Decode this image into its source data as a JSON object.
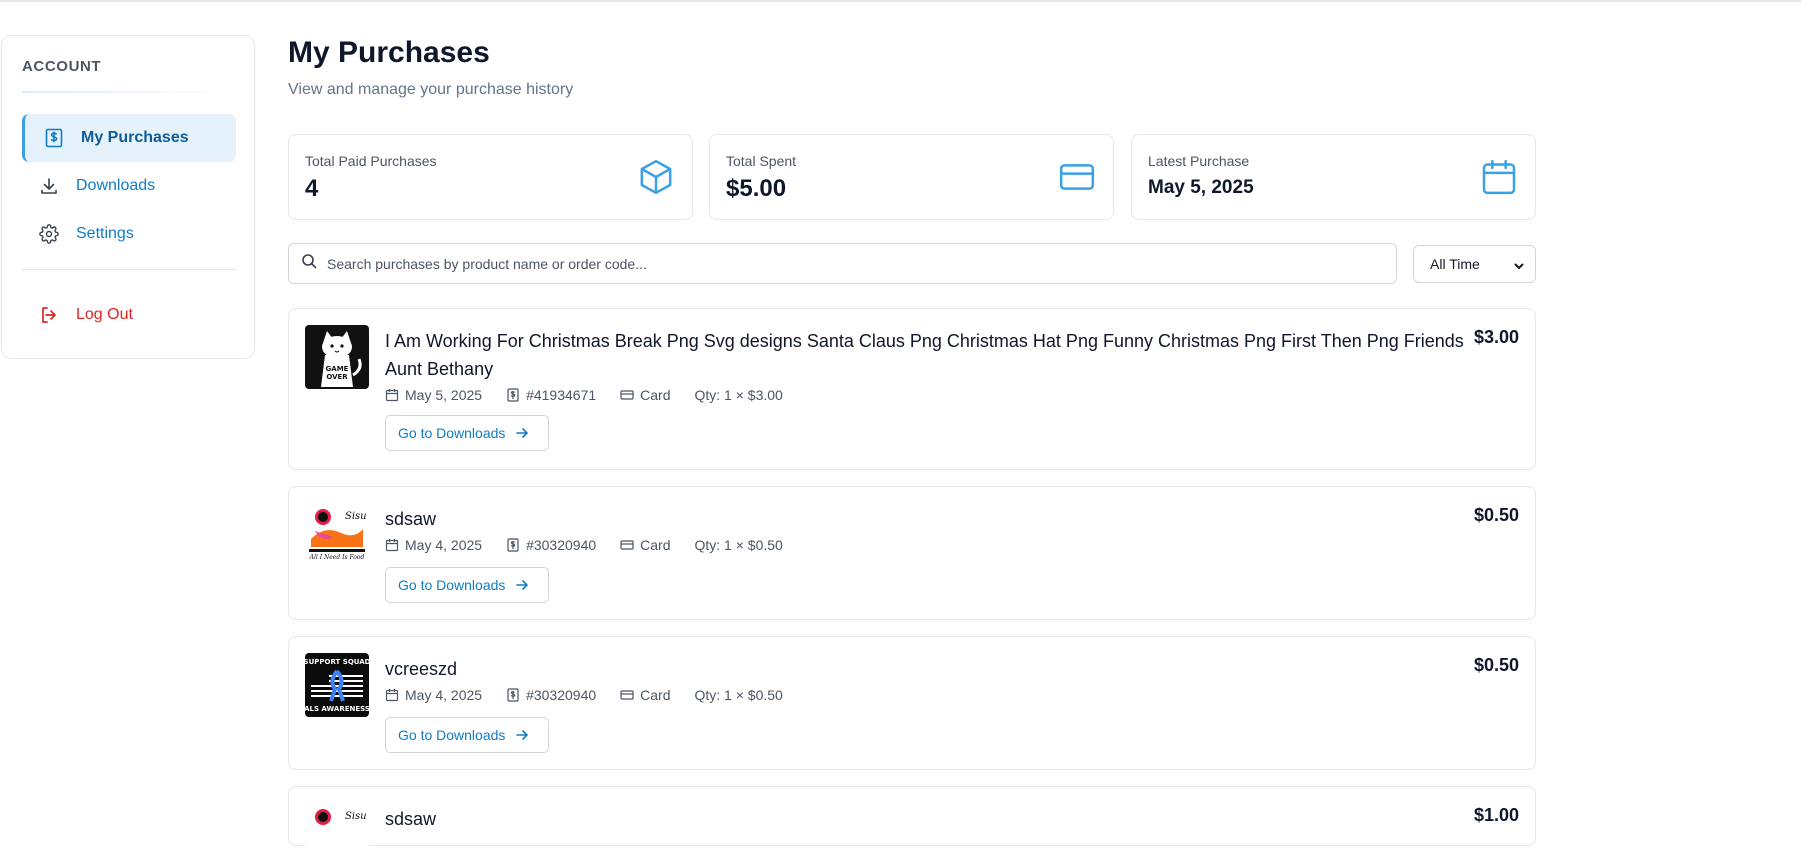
{
  "sidebar": {
    "title": "ACCOUNT",
    "items": [
      {
        "label": "My Purchases",
        "icon": "dollar-receipt-icon",
        "active": true
      },
      {
        "label": "Downloads",
        "icon": "download-icon"
      },
      {
        "label": "Settings",
        "icon": "gear-icon"
      }
    ],
    "logout_label": "Log Out"
  },
  "header": {
    "title": "My Purchases",
    "subtitle": "View and manage your purchase history"
  },
  "stats": [
    {
      "label": "Total Paid Purchases",
      "value": "4",
      "icon": "box-icon"
    },
    {
      "label": "Total Spent",
      "value": "$5.00",
      "icon": "credit-card-icon"
    },
    {
      "label": "Latest Purchase",
      "value": "May 5, 2025",
      "icon": "calendar-icon"
    }
  ],
  "search": {
    "placeholder": "Search purchases by product name or order code...",
    "value": ""
  },
  "filter": {
    "selected": "All Time"
  },
  "purchases": [
    {
      "title_line1": "I Am Working For Christmas Break Png Svg designs Santa Claus Png Christmas Hat Png Funny Christmas Png First Then Png Friends",
      "title_line2": "Aunt Bethany",
      "price": "$3.00",
      "date": "May 5, 2025",
      "order": "#41934671",
      "payment": "Card",
      "qty": "Qty: 1 × $3.00",
      "button": "Go to Downloads",
      "thumb_text": "GAME OVER"
    },
    {
      "title_line1": "sdsaw",
      "price": "$0.50",
      "date": "May 4, 2025",
      "order": "#30320940",
      "payment": "Card",
      "qty": "Qty: 1 × $0.50",
      "button": "Go to Downloads"
    },
    {
      "title_line1": "vcreeszd",
      "price": "$0.50",
      "date": "May 4, 2025",
      "order": "#30320940",
      "payment": "Card",
      "qty": "Qty: 1 × $0.50",
      "button": "Go to Downloads",
      "thumb_text_top": "SUPPORT SQUAD",
      "thumb_text_bottom": "ALS AWARENESS"
    },
    {
      "title_line1": "sdsaw",
      "price": "$1.00"
    }
  ]
}
